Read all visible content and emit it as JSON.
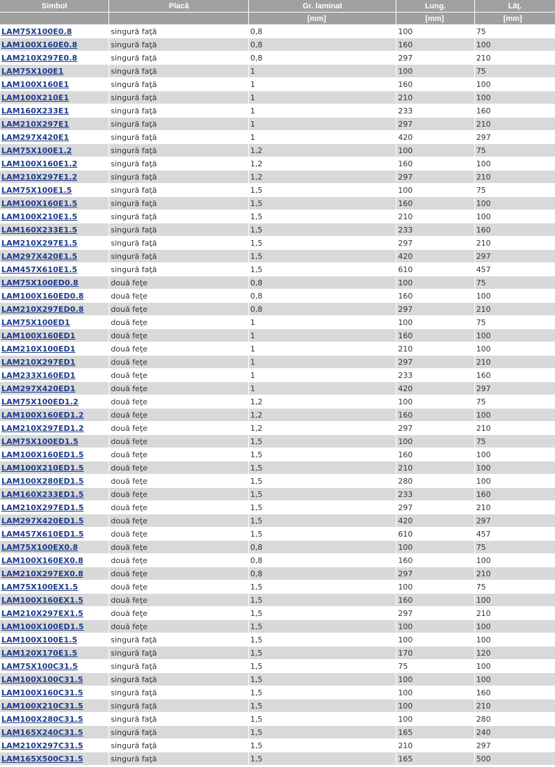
{
  "headers": {
    "simbol": "Simbol",
    "placa": "Placă",
    "gr": "Gr. laminat",
    "lung": "Lung.",
    "lat": "Lăţ.",
    "unit_gr": "[mm]",
    "unit_lung": "[mm]",
    "unit_lat": "[mm]"
  },
  "rows": [
    [
      "LAM75X100E0.8",
      "singură faţă",
      "0,8",
      "100",
      "75"
    ],
    [
      "LAM100X160E0.8",
      "singură faţă",
      "0,8",
      "160",
      "100"
    ],
    [
      "LAM210X297E0.8",
      "singură faţă",
      "0,8",
      "297",
      "210"
    ],
    [
      "LAM75X100E1",
      "singură faţă",
      "1",
      "100",
      "75"
    ],
    [
      "LAM100X160E1",
      "singură faţă",
      "1",
      "160",
      "100"
    ],
    [
      "LAM100X210E1",
      "singură faţă",
      "1",
      "210",
      "100"
    ],
    [
      "LAM160X233E1",
      "singură faţă",
      "1",
      "233",
      "160"
    ],
    [
      "LAM210X297E1",
      "singură faţă",
      "1",
      "297",
      "210"
    ],
    [
      "LAM297X420E1",
      "singură faţă",
      "1",
      "420",
      "297"
    ],
    [
      "LAM75X100E1.2",
      "singură faţă",
      "1,2",
      "100",
      "75"
    ],
    [
      "LAM100X160E1.2",
      "singură faţă",
      "1,2",
      "160",
      "100"
    ],
    [
      "LAM210X297E1.2",
      "singură faţă",
      "1,2",
      "297",
      "210"
    ],
    [
      "LAM75X100E1.5",
      "singură faţă",
      "1,5",
      "100",
      "75"
    ],
    [
      "LAM100X160E1.5",
      "singură faţă",
      "1,5",
      "160",
      "100"
    ],
    [
      "LAM100X210E1.5",
      "singură faţă",
      "1,5",
      "210",
      "100"
    ],
    [
      "LAM160X233E1.5",
      "singură faţă",
      "1,5",
      "233",
      "160"
    ],
    [
      "LAM210X297E1.5",
      "singură faţă",
      "1,5",
      "297",
      "210"
    ],
    [
      "LAM297X420E1.5",
      "singură faţă",
      "1,5",
      "420",
      "297"
    ],
    [
      "LAM457X610E1.5",
      "singură faţă",
      "1,5",
      "610",
      "457"
    ],
    [
      "LAM75X100ED0.8",
      "două feţe",
      "0,8",
      "100",
      "75"
    ],
    [
      "LAM100X160ED0.8",
      "două feţe",
      "0,8",
      "160",
      "100"
    ],
    [
      "LAM210X297ED0.8",
      "două feţe",
      "0,8",
      "297",
      "210"
    ],
    [
      "LAM75X100ED1",
      "două feţe",
      "1",
      "100",
      "75"
    ],
    [
      "LAM100X160ED1",
      "două feţe",
      "1",
      "160",
      "100"
    ],
    [
      "LAM210X100ED1",
      "două feţe",
      "1",
      "210",
      "100"
    ],
    [
      "LAM210X297ED1",
      "două feţe",
      "1",
      "297",
      "210"
    ],
    [
      "LAM233X160ED1",
      "două feţe",
      "1",
      "233",
      "160"
    ],
    [
      "LAM297X420ED1",
      "două feţe",
      "1",
      "420",
      "297"
    ],
    [
      "LAM75X100ED1.2",
      "două feţe",
      "1,2",
      "100",
      "75"
    ],
    [
      "LAM100X160ED1.2",
      "două feţe",
      "1,2",
      "160",
      "100"
    ],
    [
      "LAM210X297ED1.2",
      "două feţe",
      "1,2",
      "297",
      "210"
    ],
    [
      "LAM75X100ED1.5",
      "două feţe",
      "1,5",
      "100",
      "75"
    ],
    [
      "LAM100X160ED1.5",
      "două feţe",
      "1,5",
      "160",
      "100"
    ],
    [
      "LAM100X210ED1.5",
      "două feţe",
      "1,5",
      "210",
      "100"
    ],
    [
      "LAM100X280ED1.5",
      "două feţe",
      "1,5",
      "280",
      "100"
    ],
    [
      "LAM160X233ED1.5",
      "două feţe",
      "1,5",
      "233",
      "160"
    ],
    [
      "LAM210X297ED1.5",
      "două feţe",
      "1,5",
      "297",
      "210"
    ],
    [
      "LAM297X420ED1.5",
      "două feţe",
      "1,5",
      "420",
      "297"
    ],
    [
      "LAM457X610ED1.5",
      "două feţe",
      "1,5",
      "610",
      "457"
    ],
    [
      "LAM75X100EX0.8",
      "două feţe",
      "0,8",
      "100",
      "75"
    ],
    [
      "LAM100X160EX0.8",
      "două feţe",
      "0,8",
      "160",
      "100"
    ],
    [
      "LAM210X297EX0.8",
      "două feţe",
      "0,8",
      "297",
      "210"
    ],
    [
      "LAM75X100EX1.5",
      "două feţe",
      "1,5",
      "100",
      "75"
    ],
    [
      "LAM100X160EX1.5",
      "două feţe",
      "1,5",
      "160",
      "100"
    ],
    [
      "LAM210X297EX1.5",
      "două feţe",
      "1,5",
      "297",
      "210"
    ],
    [
      "LAM100X100ED1.5",
      "două feţe",
      "1,5",
      "100",
      "100"
    ],
    [
      "LAM100X100E1.5",
      "singură faţă",
      "1,5",
      "100",
      "100"
    ],
    [
      "LAM120X170E1.5",
      "singură faţă",
      "1,5",
      "170",
      "120"
    ],
    [
      "LAM75X100C31.5",
      "singură faţă",
      "1,5",
      "75",
      "100"
    ],
    [
      "LAM100X100C31.5",
      "singură faţă",
      "1,5",
      "100",
      "100"
    ],
    [
      "LAM100X160C31.5",
      "singură faţă",
      "1,5",
      "100",
      "160"
    ],
    [
      "LAM100X210C31.5",
      "singură faţă",
      "1,5",
      "100",
      "210"
    ],
    [
      "LAM100X280C31.5",
      "singură faţă",
      "1,5",
      "100",
      "280"
    ],
    [
      "LAM165X240C31.5",
      "singură faţă",
      "1,5",
      "165",
      "240"
    ],
    [
      "LAM210X297C31.5",
      "singură faţă",
      "1,5",
      "210",
      "297"
    ],
    [
      "LAM165X500C31.5",
      "singură faţă",
      "1,5",
      "165",
      "500"
    ]
  ]
}
